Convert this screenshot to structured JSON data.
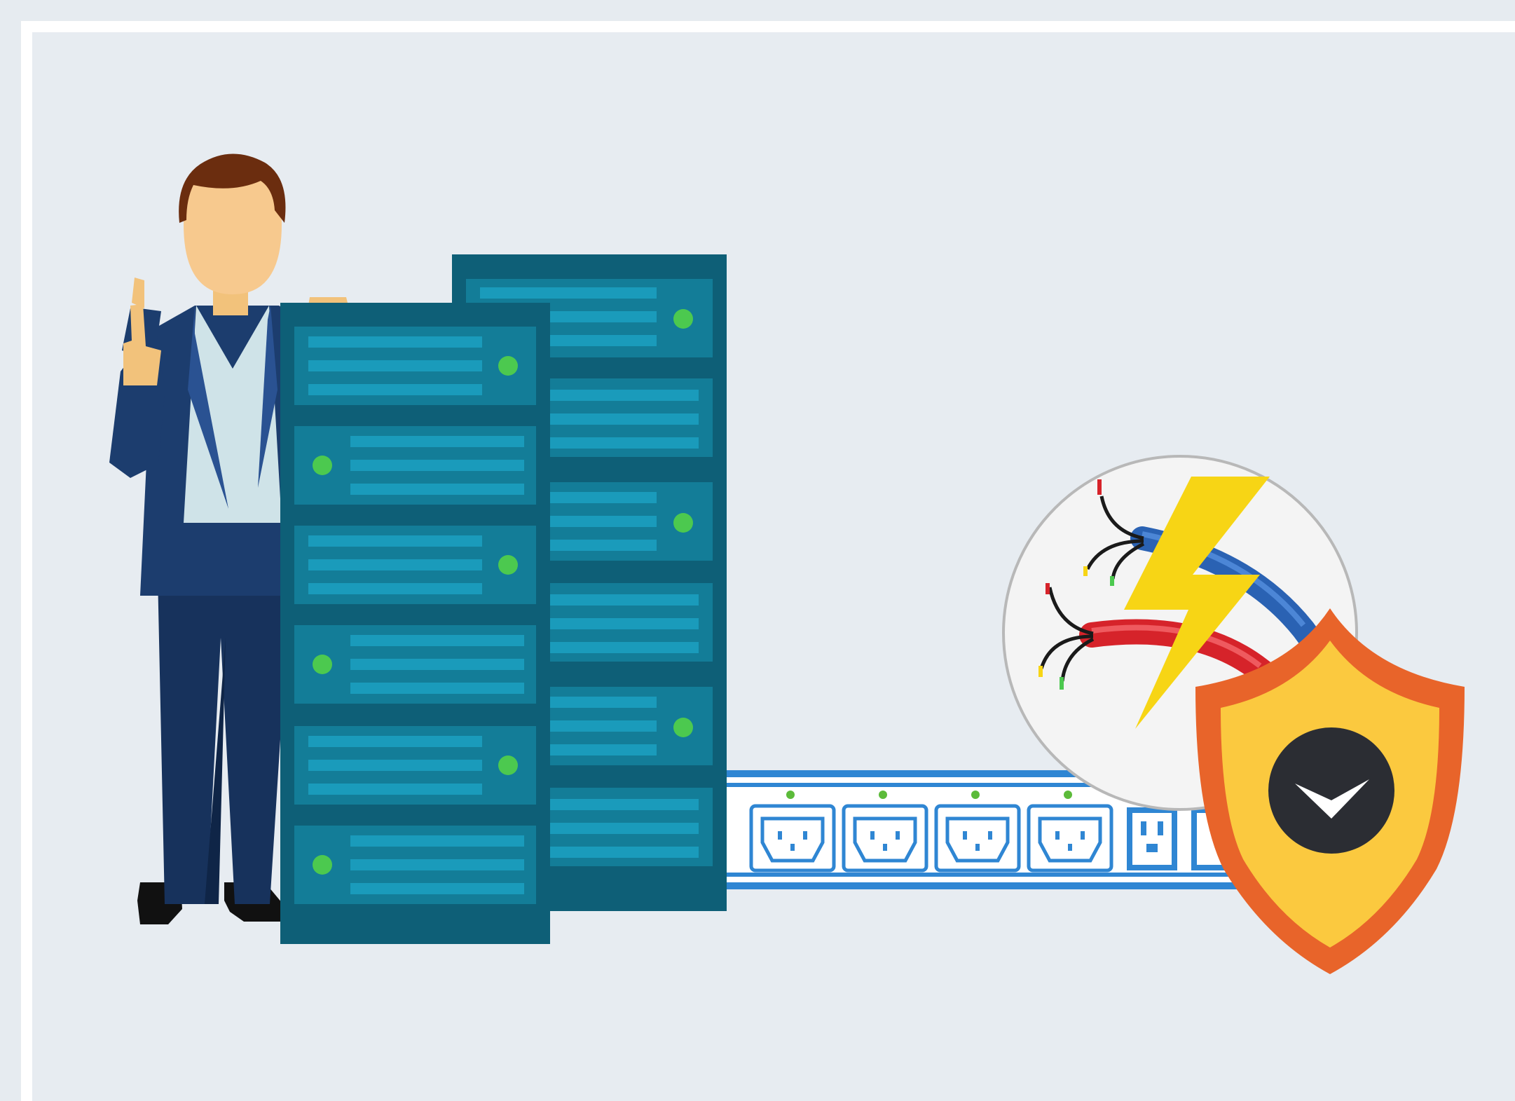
{
  "illustration": {
    "subjects": [
      "person-icon",
      "server-rack-icon",
      "power-strip-icon",
      "cable-icon",
      "lightning-icon",
      "shield-icon",
      "checkmark-icon"
    ]
  },
  "colors": {
    "background": "#e7ecf1",
    "frame": "#ffffff",
    "rack_dark": "#0e5f77",
    "rack_panel": "#137d98",
    "rack_bar": "#1a9bbb",
    "led_green": "#4cc94f",
    "suit_navy": "#1c3d6e",
    "power_strip_blue": "#2f86d3",
    "lightning_yellow": "#f7d515",
    "shield_orange": "#e8642a",
    "shield_yellow": "#fbc93f",
    "cable_red": "#d6232a",
    "cable_blue": "#2a62b3"
  }
}
